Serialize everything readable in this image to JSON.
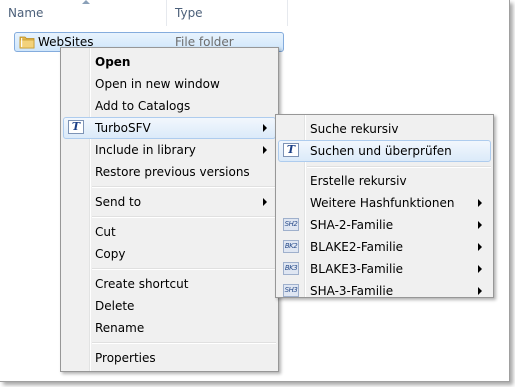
{
  "header": {
    "name_label": "Name",
    "type_label": "Type"
  },
  "file": {
    "name": "WebSites",
    "type": "File folder"
  },
  "context_menu": {
    "items": [
      {
        "label": "Open"
      },
      {
        "label": "Open in new window"
      },
      {
        "label": "Add to Catalogs"
      },
      {
        "label": "TurboSFV",
        "icon": "turbosfv-icon"
      },
      {
        "label": "Include in library"
      },
      {
        "label": "Restore previous versions"
      },
      {
        "label": "Send to"
      },
      {
        "label": "Cut"
      },
      {
        "label": "Copy"
      },
      {
        "label": "Create shortcut"
      },
      {
        "label": "Delete"
      },
      {
        "label": "Rename"
      },
      {
        "label": "Properties"
      }
    ]
  },
  "submenu": {
    "turbo_icon_glyph": "T",
    "items": [
      {
        "label": "Suche rekursiv"
      },
      {
        "label": "Suchen und überprüfen"
      },
      {
        "label": "Erstelle rekursiv"
      },
      {
        "label": "Weitere Hashfunktionen"
      },
      {
        "label": "SHA-2-Familie",
        "icon_text": "SH2"
      },
      {
        "label": "BLAKE2-Familie",
        "icon_text": "BK2"
      },
      {
        "label": "BLAKE3-Familie",
        "icon_text": "BK3"
      },
      {
        "label": "SHA-3-Familie",
        "icon_text": "SH3"
      }
    ]
  }
}
